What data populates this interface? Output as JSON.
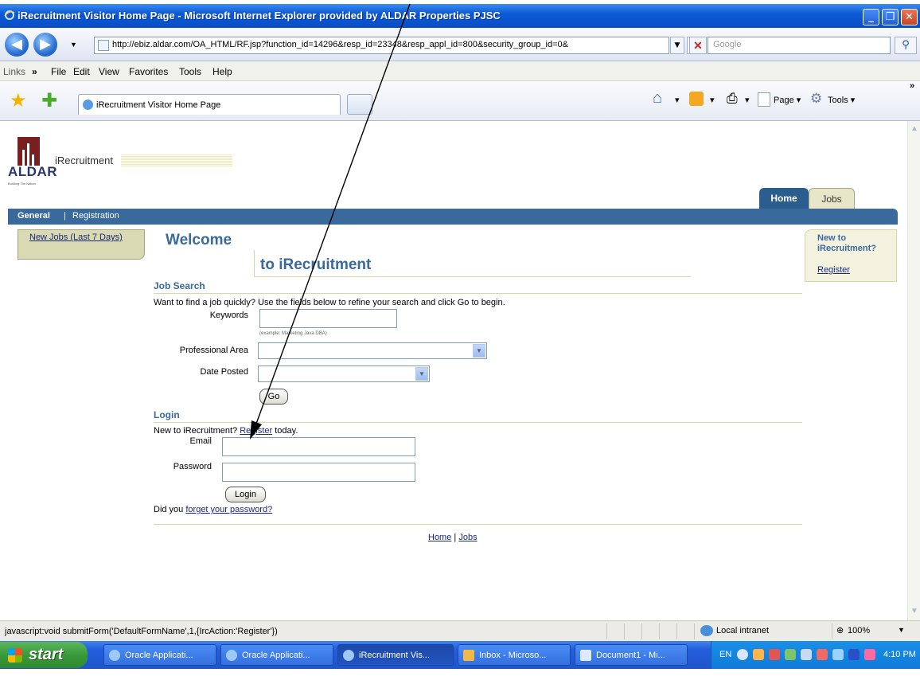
{
  "window": {
    "title": "iRecruitment Visitor Home Page - Microsoft Internet Explorer provided by ALDAR Properties PJSC",
    "minimize": "_",
    "maximize": "❐",
    "close": "✕"
  },
  "addressbar": {
    "url": "http://ebiz.aldar.com/OA_HTML/RF.jsp?function_id=14296&resp_id=23348&resp_appl_id=800&security_group_id=0&",
    "search_placeholder": "Google"
  },
  "menubar": {
    "links_label": "Links",
    "items": [
      "File",
      "Edit",
      "View",
      "Favorites",
      "Tools",
      "Help"
    ]
  },
  "favbar": {
    "tab_title": "iRecruitment Visitor Home Page",
    "page_label": "Page",
    "tools_label": "Tools"
  },
  "app": {
    "logo_text": "ALDAR",
    "logo_tagline": "Building The Nation",
    "app_name": "iRecruitment",
    "tabs": {
      "home": "Home",
      "jobs": "Jobs"
    },
    "subnav": {
      "general": "General",
      "separator": "|",
      "registration": "Registration"
    },
    "side_link": "New Jobs (Last 7 Days)",
    "welcome": "Welcome",
    "to_irecruitment": "to iRecruitment",
    "newto": {
      "heading": "New to iRecruitment?",
      "register": "Register"
    },
    "job_search": {
      "heading": "Job Search",
      "instructions": "Want to find a job quickly? Use the fields below to refine your search and click Go to begin.",
      "keywords_label": "Keywords",
      "keywords_value": "",
      "keywords_hint": "(example: Marketing Java DBA)",
      "professional_area_label": "Professional Area",
      "professional_area_value": "",
      "date_posted_label": "Date Posted",
      "date_posted_value": "",
      "go_button": "Go"
    },
    "login": {
      "heading": "Login",
      "new_prefix": "New to iRecruitment?",
      "register_link": "Register",
      "new_suffix": "today.",
      "email_label": "Email",
      "email_value": "",
      "password_label": "Password",
      "password_value": "",
      "login_button": "Login",
      "forgot_prefix": "Did you",
      "forgot_link": "forget your password?"
    },
    "footer": {
      "home": "Home",
      "separator": "|",
      "jobs": "Jobs"
    }
  },
  "statusbar": {
    "message": "javascript:void submitForm('DefaultFormName',1,{IrcAction:'Register'})",
    "zone": "Local intranet",
    "zoom": "100%"
  },
  "taskbar": {
    "start": "start",
    "tasks": [
      "Oracle Applicati...",
      "Oracle Applicati...",
      "iRecruitment Vis...",
      "Inbox - Microso...",
      "Document1 - Mi..."
    ],
    "language": "EN",
    "clock": "4:10 PM"
  },
  "colors": {
    "brand_blue": "#3a6a9b",
    "tab_dark": "#2c5d8f",
    "khaki": "#d9d9b3",
    "xp_blue": "#245edb"
  }
}
